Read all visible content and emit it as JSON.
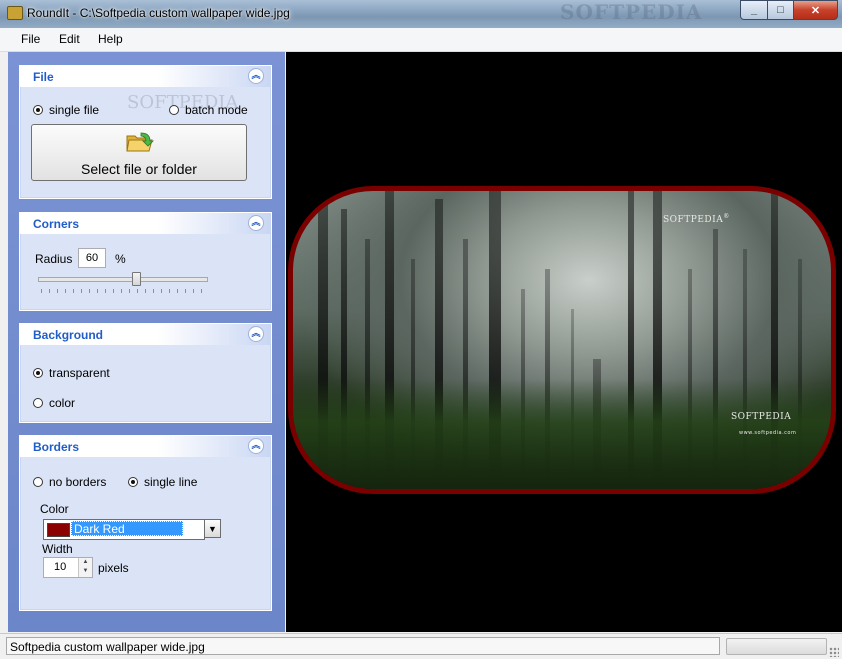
{
  "window": {
    "title": "RoundIt - C:\\Softpedia custom wallpaper wide.jpg",
    "bg_watermark": "SOFTPEDIA"
  },
  "menu": {
    "items": [
      "File",
      "Edit",
      "Help"
    ]
  },
  "file_group": {
    "title": "File",
    "mode_single": "single file",
    "mode_batch": "batch mode",
    "selected_mode": "single file",
    "select_button": "Select file or folder",
    "watermark": "SOFTPEDIA"
  },
  "corners_group": {
    "title": "Corners",
    "radius_label": "Radius",
    "radius_value": "60",
    "radius_unit": "%",
    "slider_percent": 60
  },
  "background_group": {
    "title": "Background",
    "opt_transparent": "transparent",
    "opt_color": "color",
    "selected": "transparent"
  },
  "borders_group": {
    "title": "Borders",
    "opt_none": "no borders",
    "opt_single": "single line",
    "selected": "single line",
    "color_label": "Color",
    "color_name": "Dark Red",
    "color_hex": "#8b0000",
    "width_label": "Width",
    "width_value": "10",
    "width_unit": "pixels"
  },
  "preview": {
    "watermark_top": "SOFTPEDIA",
    "watermark_tm": "®",
    "watermark_bottom": "SOFTPEDIA",
    "watermark_url": "www.softpedia.com"
  },
  "status": {
    "filename": "Softpedia custom wallpaper wide.jpg"
  }
}
